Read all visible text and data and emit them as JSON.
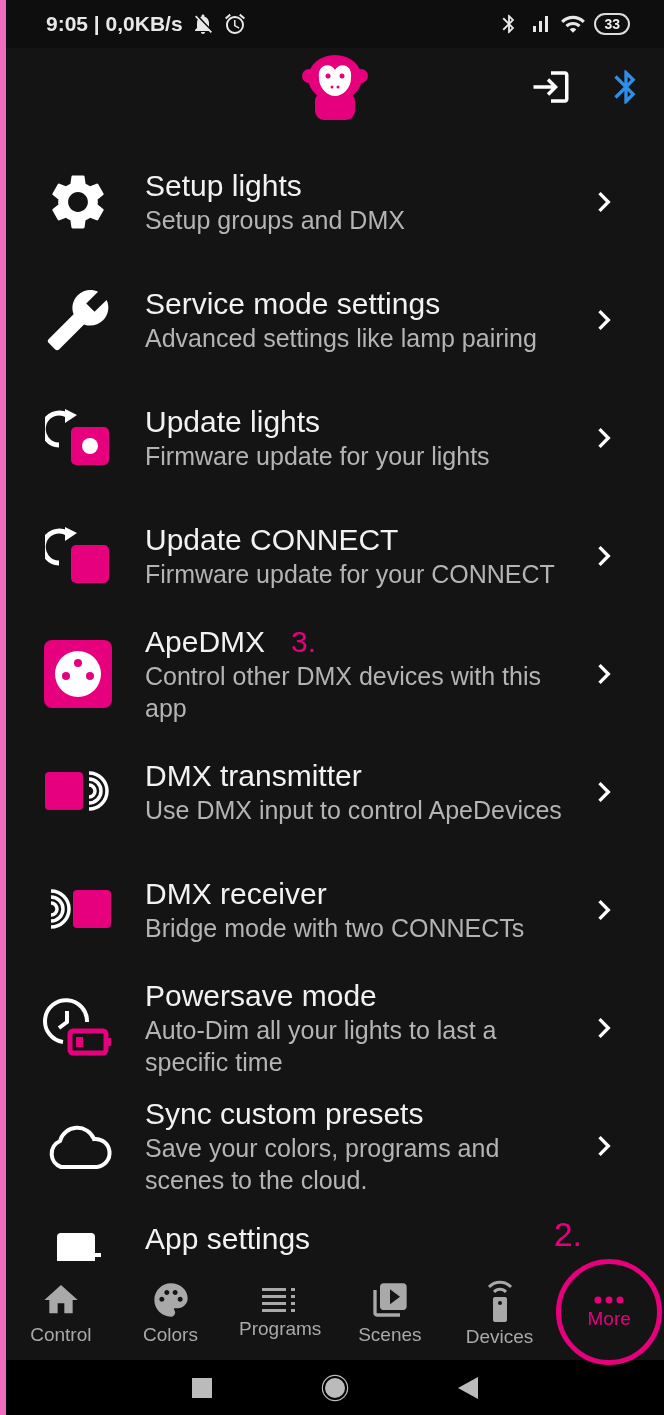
{
  "status_bar": {
    "time_and_speed": "9:05 | 0,0KB/s",
    "battery": "33"
  },
  "menu": [
    {
      "title": "Setup lights",
      "subtitle": "Setup groups and DMX"
    },
    {
      "title": "Service mode settings",
      "subtitle": "Advanced settings like lamp pairing"
    },
    {
      "title": "Update lights",
      "subtitle": "Firmware update for your lights"
    },
    {
      "title": "Update CONNECT",
      "subtitle": "Firmware update for your CONNECT"
    },
    {
      "title": "ApeDMX",
      "subtitle": "Control other DMX devices with this app",
      "annotation": "3."
    },
    {
      "title": "DMX transmitter",
      "subtitle": "Use DMX input to control ApeDevices"
    },
    {
      "title": "DMX receiver",
      "subtitle": "Bridge mode with two CONNECTs"
    },
    {
      "title": "Powersave mode",
      "subtitle": "Auto-Dim all your lights to last a specific time"
    },
    {
      "title": "Sync custom presets",
      "subtitle": "Save your colors, programs and scenes to the cloud."
    },
    {
      "title": "App settings"
    }
  ],
  "bottom_nav": {
    "annotation": "2.",
    "items": [
      {
        "label": "Control",
        "selected": false,
        "circled": false
      },
      {
        "label": "Colors",
        "selected": false,
        "circled": false
      },
      {
        "label": "Programs",
        "selected": false,
        "circled": false
      },
      {
        "label": "Scenes",
        "selected": false,
        "circled": false
      },
      {
        "label": "Devices",
        "selected": false,
        "circled": false
      },
      {
        "label": "More",
        "selected": true,
        "circled": true
      }
    ]
  }
}
